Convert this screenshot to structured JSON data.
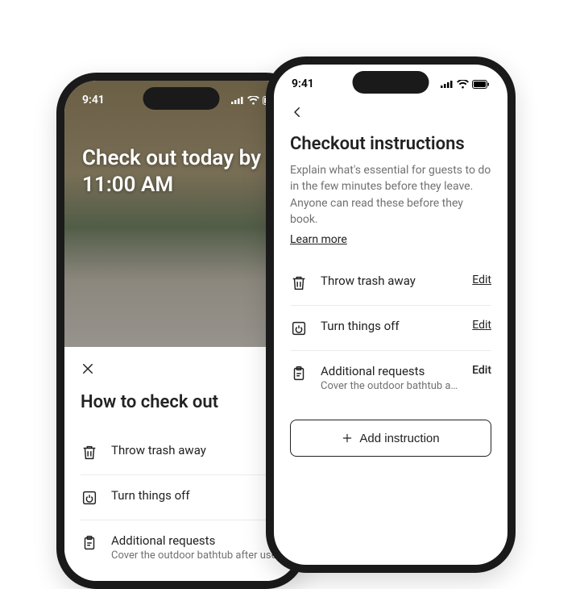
{
  "status": {
    "time": "9:41"
  },
  "back_phone": {
    "hero_title": "Check out today by 11:00 AM",
    "sheet_title": "How to check out",
    "items": [
      {
        "icon": "trash-icon",
        "title": "Throw trash away"
      },
      {
        "icon": "power-icon",
        "title": "Turn things off"
      },
      {
        "icon": "clipboard-icon",
        "title": "Additional requests",
        "subtitle": "Cover the outdoor bathtub after use"
      }
    ]
  },
  "front_phone": {
    "title": "Checkout instructions",
    "description": "Explain what's essential for guests to do in the few minutes before they leave. Anyone can read these before they book.",
    "learn_more": "Learn more",
    "edit_label": "Edit",
    "add_label": "Add instruction",
    "items": [
      {
        "icon": "trash-icon",
        "title": "Throw trash away"
      },
      {
        "icon": "power-icon",
        "title": "Turn things off"
      },
      {
        "icon": "clipboard-icon",
        "title": "Additional requests",
        "subtitle": "Cover the outdoor bathtub after use"
      }
    ]
  }
}
